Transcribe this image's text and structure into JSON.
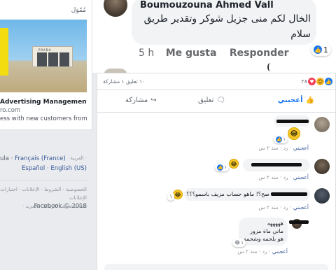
{
  "sidebar": {
    "ad": {
      "sponsored_label": "مُمّوَل",
      "title": "Advertising Management fi...",
      "domain": "ro.com",
      "description": "ess with new customers from",
      "store_sign": "PRADA"
    },
    "languages": {
      "line1_prefix": "ula · ",
      "line1_link": "Français (France)",
      "line1_ar": "العربية ·",
      "line2": "Español · English (US)"
    },
    "footer": {
      "links_line1": "الخصوصية · الشروط · الإعلانات · اختيارات الإعلانات",
      "links_line2": "ملفات تعريف الارتباط · المزيد ·",
      "copyright": "Facebook © 2018"
    }
  },
  "top_comment": {
    "author": "Boumouzouna Ahmed Vall",
    "text": "الخال لكم منى جزيل شوكر وتقدير طريق سلام",
    "reaction_count": "1",
    "time": "5 h",
    "like_label": "Me gusta",
    "reply_label": "Responder"
  },
  "post": {
    "stats": {
      "counts_text": "١٠ تعليق  ١ مشاركة",
      "reactions_count": "٢٨"
    },
    "actions": {
      "like": "أعجبني",
      "comment": "تعليق",
      "share": "مشاركة"
    },
    "comments": [
      {
        "text": "",
        "reaction_count": "١",
        "meta_like": "أعجبني",
        "meta_rest": " · رد · منذ ٢ س"
      },
      {
        "text": "",
        "reaction_count": "١",
        "meta_like": "أعجبني",
        "meta_rest": " · رد · منذ ٢ س"
      },
      {
        "text": "صح؟! ماهو حساب مزيف باسمو؟؟؟",
        "reaction_count": "١",
        "meta_like": "أعجبني",
        "meta_rest": " · رد · منذ ٢ س"
      },
      {
        "line1": "هههههه",
        "line2": "ماني ماة مزور",
        "line3": "هو بلحمه وشحمه",
        "reaction_count": "١",
        "meta_like": "أعجبني",
        "meta_rest": " · رد · منذ ٢ س"
      }
    ]
  }
}
